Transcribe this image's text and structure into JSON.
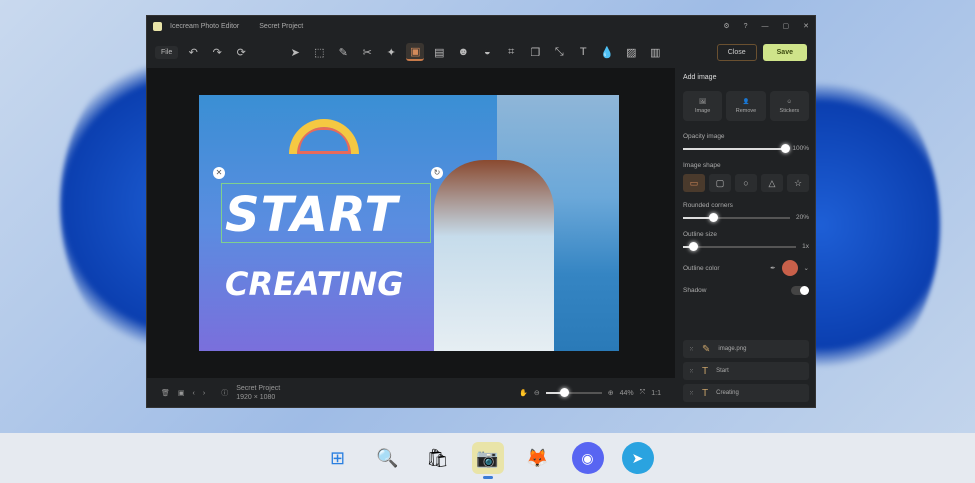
{
  "window": {
    "app_name": "Icecream Photo Editor",
    "project": "Secret Project"
  },
  "toolbar": {
    "file": "File",
    "close": "Close",
    "save": "Save"
  },
  "canvas": {
    "line1": "START",
    "line2": "CREATING"
  },
  "bottom": {
    "project": "Secret Project",
    "size": "1920 × 1080",
    "zoom": "44%",
    "ratio": "1:1"
  },
  "panel": {
    "title": "Add image",
    "add": [
      {
        "label": "Image"
      },
      {
        "label": "Remove"
      },
      {
        "label": "Stickers"
      }
    ],
    "opacity_label": "Opacity image",
    "opacity_value": "100%",
    "opacity": 1.0,
    "shape_label": "Image shape",
    "rounded_label": "Rounded corners",
    "rounded_value": "20%",
    "rounded": 0.2,
    "outline_label": "Outline size",
    "outline_value": "1x",
    "outline": 0.05,
    "outline_color_label": "Outline color",
    "outline_color": "#c8604a",
    "shadow_label": "Shadow",
    "layers": [
      {
        "name": "image.png"
      },
      {
        "name": "Start"
      },
      {
        "name": "Creating"
      }
    ]
  }
}
